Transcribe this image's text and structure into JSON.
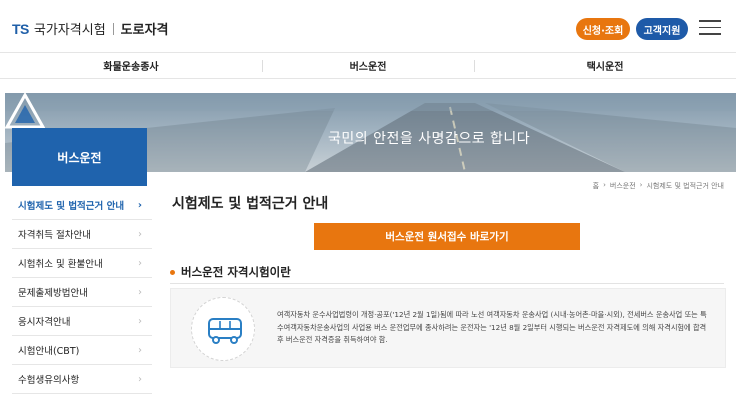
{
  "header": {
    "logo_ts": "TS",
    "logo_name": "국가자격시험",
    "logo_sub": "도로자격",
    "btn_apply": "신청·조회",
    "btn_support": "고객지원"
  },
  "topnav": {
    "items": [
      "화물운송종사",
      "버스운전",
      "택시운전"
    ]
  },
  "banner": {
    "slogan": "국민의 안전을 사명감으로 합니다"
  },
  "sidebar": {
    "title": "버스운전",
    "items": [
      {
        "label": "시험제도 및 법적근거 안내"
      },
      {
        "label": "자격취득 절차안내"
      },
      {
        "label": "시험취소 및 환불안내"
      },
      {
        "label": "문제출제방법안내"
      },
      {
        "label": "응시자격안내"
      },
      {
        "label": "시험안내(CBT)"
      },
      {
        "label": "수험생유의사항"
      }
    ],
    "chevron": "›"
  },
  "breadcrumb": [
    "홈",
    "버스운전",
    "시험제도 및 법적근거 안내"
  ],
  "breadcrumb_sep": "›",
  "main": {
    "page_title": "시험제도 및 법적근거 안내",
    "apply_button": "버스운전 원서접수 바로가기",
    "section_title": "버스운전 자격시험이란",
    "description": "여객자동차 운수사업법령이 개정·공포('12년 2월 1일)됨에 따라 노선 여객자동차 운송사업 (시내·농어촌·마을·시외), 전세버스 운송사업 또는 특수여객자동차운송사업의 사업용 버스 운전업무에 종사하려는 운전자는 '12년 8월 2일부터 시행되는 버스운전 자격제도에 의해 자격시험에 합격 후 버스운전 자격증을 취득하여야 함."
  },
  "icons": {
    "bus": "bus-icon",
    "menu": "hamburger-icon"
  },
  "colors": {
    "accent_orange": "#e8760f",
    "brand_blue": "#1f63ad"
  }
}
